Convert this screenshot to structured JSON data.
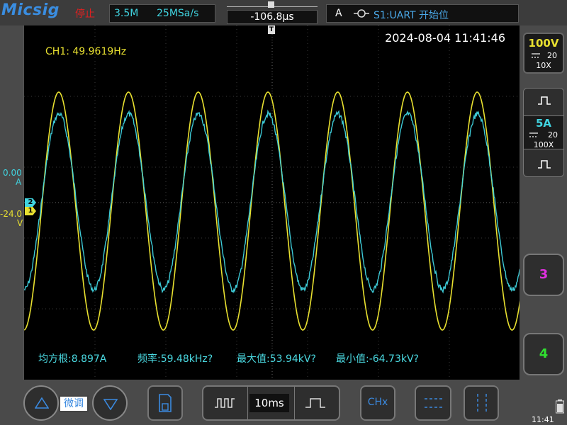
{
  "topbar": {
    "logo": "Micsig",
    "status": "停止",
    "memory_depth": "3.5M",
    "sample_rate": "25MSa/s",
    "horizontal_position": "-106.8µs",
    "trigger_source": "A",
    "trigger_mode": "S1:UART 开始位"
  },
  "screen": {
    "datetime": "2024-08-04 11:41:46",
    "frequency_readout": "CH1: 49.9619Hz",
    "trigger_marker": "T",
    "left_labels": {
      "offset_top": "0.00",
      "offset_unit": "A",
      "offset_bottom": "-24.0",
      "offset_bottom_unit": "V"
    },
    "channel_markers": [
      "2",
      "1"
    ],
    "measurements": [
      "均方根:8.897A",
      "频率:59.48kHz?",
      "最大值:53.94kV?",
      "最小值:-64.73kV?"
    ]
  },
  "right_panel": {
    "ch1": {
      "scale": "100V",
      "bandwidth": "20",
      "probe": "10X",
      "color": "#e8e030"
    },
    "ch2": {
      "scale": "5A",
      "bandwidth": "20",
      "probe": "100X",
      "color": "#40d4e0"
    },
    "ch3_label": "3",
    "ch4_label": "4"
  },
  "bottom": {
    "fine_label": "微调",
    "timebase": "10ms",
    "chx_label": "CHx",
    "clock": "11:41"
  },
  "colors": {
    "ch1": "#e8e030",
    "ch2": "#40d4e0",
    "ch3": "#e030e0",
    "ch4": "#30e030"
  }
}
